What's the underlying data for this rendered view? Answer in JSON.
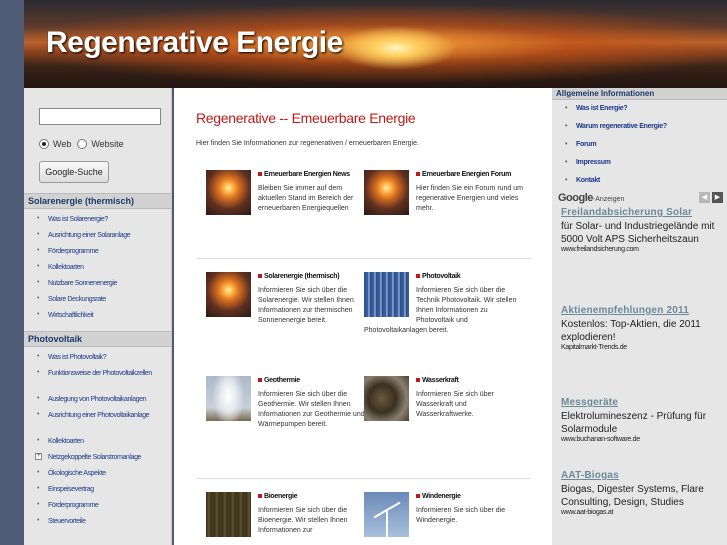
{
  "header": {
    "title": "Regenerative Energie"
  },
  "search": {
    "radio_web": "Web",
    "radio_website": "Website",
    "button": "Google-Suche"
  },
  "left_sections": [
    {
      "title": "Solarenergie (thermisch)",
      "items": [
        "Was ist Solarenergie?",
        "Ausrichtung einer Solaranlage",
        "Förderprogramme",
        "Kollektoarten",
        "Nutzbare Sonnenenergie",
        "Solare Deckungsrate",
        "Wirtschaftlichkeit"
      ]
    },
    {
      "title": "Photovoltaik",
      "items": [
        "Was ist Photovoltaik?",
        "Funktionsweise der Photovoltaikzellen",
        "Auslegung von Photovoltaikanlagen",
        "Ausrichtung einer Photovoltaikanlage",
        "Kollektoarten",
        "Netzgekoppelte Solarstromanlage",
        "Ökologische Aspekte",
        "Einspeisevertrag",
        "Förderprogramme",
        "Steuervorteile"
      ]
    }
  ],
  "main": {
    "title": "Regenerative -- Emeuerbare Energie",
    "intro": "Hier finden Sie Informationen zur regenerativen / erneuerbaren Energie.",
    "cards": [
      {
        "title": "Erneuerbare Energien News",
        "text": "Bleiben Sie immer auf dem aktuellen Stand im Bereich der erneuerbaren Energiequellen"
      },
      {
        "title": "Erneuerbare Energien Forum",
        "text": "Hier finden Sie ein Forum rund um regenerative Energien und vieles mehr."
      },
      {
        "title": "Solarenergie (thermisch)",
        "text": "Informieren Sie sich über die Solarenergie. Wir stellen Ihnen Informationen zur thermischen Sonnenenergie bereit."
      },
      {
        "title": "Photovoltaik",
        "text": "Informieren Sie sich über die Technik Photovoltaik. Wir stellen Ihnen Informationen zu Photovoltaik und Photovoltaikanlagen bereit."
      },
      {
        "title": "Geothermie",
        "text": "Informieren Sie sich über die Geothermie. Wir stellen Ihnen Informationen zur Geothermie und Wärmepumpen bereit."
      },
      {
        "title": "Wasserkraft",
        "text": "Informieren Sie sich über Wasserkraft und Wasserkraftwerke."
      },
      {
        "title": "Bioenergie",
        "text": "Informieren Sie sich über die Bioenergie. Wir stellen Ihnen Informationen zur"
      },
      {
        "title": "Windenergie",
        "text": "Informieren Sie sich über die Windenergie."
      }
    ]
  },
  "right": {
    "title": "Allgemeine Informationen",
    "items": [
      "Was ist Energie?",
      "Warum regenerative Energie?",
      "Forum",
      "Impressum",
      "Kontakt"
    ],
    "ads_brand": "Google",
    "ads_label": "-Anzeigen",
    "ads": [
      {
        "title": "Freilandabsicherung Solar",
        "body": "für Solar- und Industriegelände mit 5000 Volt APS Sicherheitszaun",
        "url": "www.freilandsicherung.com"
      },
      {
        "title": "Aktienempfehlungen 2011",
        "body": "Kostenlos: Top-Aktien, die 2011 explodieren!",
        "url": "Kapitalmarkt-Trends.de"
      },
      {
        "title": "Messgeräte",
        "body": "Elektrolumineszenz - Prüfung für Solarmodule",
        "url": "www.buchanan-software.de"
      },
      {
        "title": "AAT-Biogas",
        "body": "Biogas, Digester Systems, Flare Consulting, Design, Studies",
        "url": "www.aat-biogas.at"
      }
    ]
  }
}
